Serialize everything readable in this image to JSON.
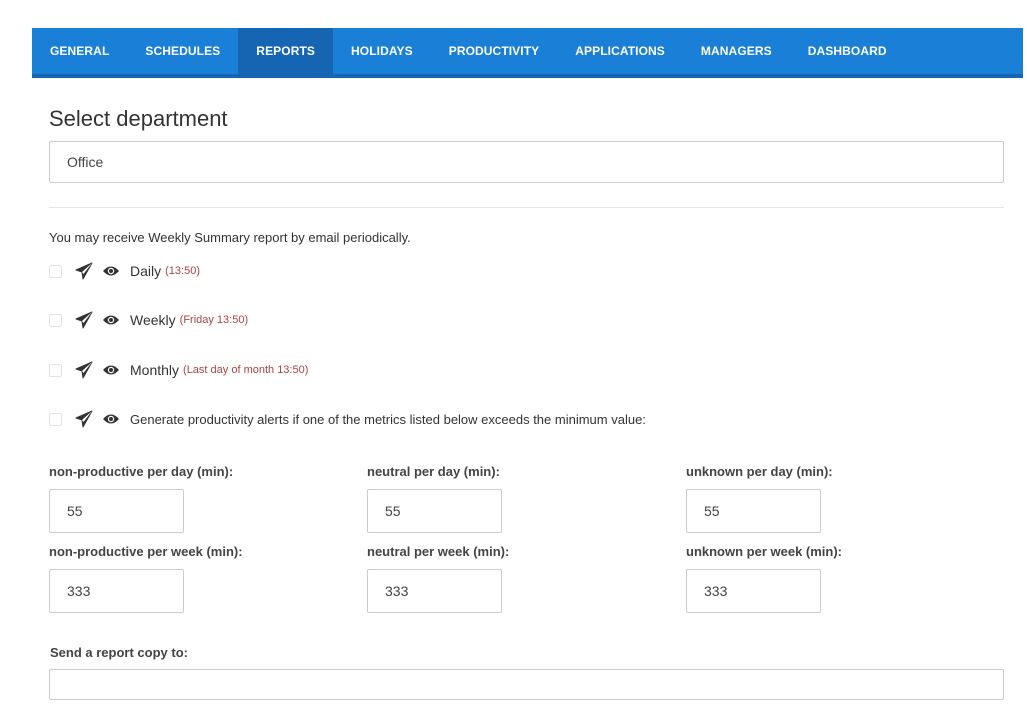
{
  "nav": {
    "items": [
      {
        "label": "GENERAL",
        "active": false
      },
      {
        "label": "SCHEDULES",
        "active": false
      },
      {
        "label": "REPORTS",
        "active": true
      },
      {
        "label": "HOLIDAYS",
        "active": false
      },
      {
        "label": "PRODUCTIVITY",
        "active": false
      },
      {
        "label": "APPLICATIONS",
        "active": false
      },
      {
        "label": "MANAGERS",
        "active": false
      },
      {
        "label": "DASHBOARD",
        "active": false
      }
    ]
  },
  "department": {
    "title": "Select department",
    "selected": "Office"
  },
  "reports": {
    "intro": "You may receive Weekly Summary report by email periodically.",
    "items": [
      {
        "label": "Daily",
        "time": "(13:50)"
      },
      {
        "label": "Weekly",
        "time": "(Friday 13:50)"
      },
      {
        "label": "Monthly",
        "time": "(Last day of month 13:50)"
      },
      {
        "label": "Generate productivity alerts if one of the metrics listed below exceeds the minimum value:",
        "time": ""
      }
    ]
  },
  "metrics": {
    "nonproductive_day": {
      "label": "non-productive per day (min):",
      "value": "55"
    },
    "neutral_day": {
      "label": "neutral per day (min):",
      "value": "55"
    },
    "unknown_day": {
      "label": "unknown per day (min):",
      "value": "55"
    },
    "nonproductive_week": {
      "label": "non-productive per week (min):",
      "value": "333"
    },
    "neutral_week": {
      "label": "neutral per week (min):",
      "value": "333"
    },
    "unknown_week": {
      "label": "unknown per week (min):",
      "value": "333"
    }
  },
  "copy": {
    "label": "Send a report copy to:",
    "value": ""
  },
  "colors": {
    "nav_bg": "#1a7fd6",
    "nav_active": "#1565b3",
    "time_text": "#a94442"
  },
  "icons": {
    "send": "paper-plane-icon",
    "view": "eye-icon"
  }
}
